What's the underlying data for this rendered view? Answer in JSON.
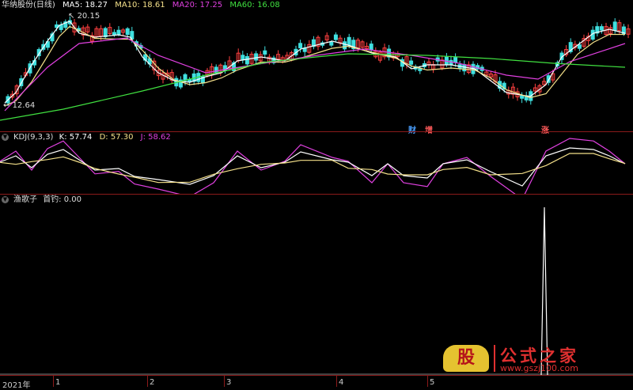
{
  "main": {
    "stock_name": "华纳股份(日线)",
    "ma": [
      {
        "label": "MA5: 18.27",
        "color": "#ffffff"
      },
      {
        "label": "MA10: 18.61",
        "color": "#f4e08a"
      },
      {
        "label": "MA20: 17.25",
        "color": "#e040e0"
      },
      {
        "label": "MA60: 16.08",
        "color": "#40e040"
      }
    ],
    "high_label": "20.15",
    "low_label": "12.64",
    "events": [
      {
        "text": "财",
        "color": "#4aa0ff"
      },
      {
        "text": "增",
        "color": "#ff5a5a"
      },
      {
        "text": "涨",
        "color": "#ff5a5a"
      }
    ]
  },
  "kdj": {
    "title": "KDJ(9,3,3)",
    "k_label": "K: 57.74",
    "d_label": "D: 57.30",
    "j_label": "J: 58.62",
    "k_color": "#ffffff",
    "d_color": "#f4e08a",
    "j_color": "#e040e0"
  },
  "indicator": {
    "title": "渔歌子",
    "value_label": "首钓: 0.00"
  },
  "axis": {
    "labels": [
      "2021年",
      "1",
      "2",
      "3",
      "4",
      "5"
    ]
  },
  "watermark": {
    "logo": "股",
    "name": "公式之家",
    "url": "www.gszj100.com"
  },
  "colors": {
    "up": "#ff4040",
    "down": "#40e0e0",
    "border": "#8b1a1a"
  }
}
